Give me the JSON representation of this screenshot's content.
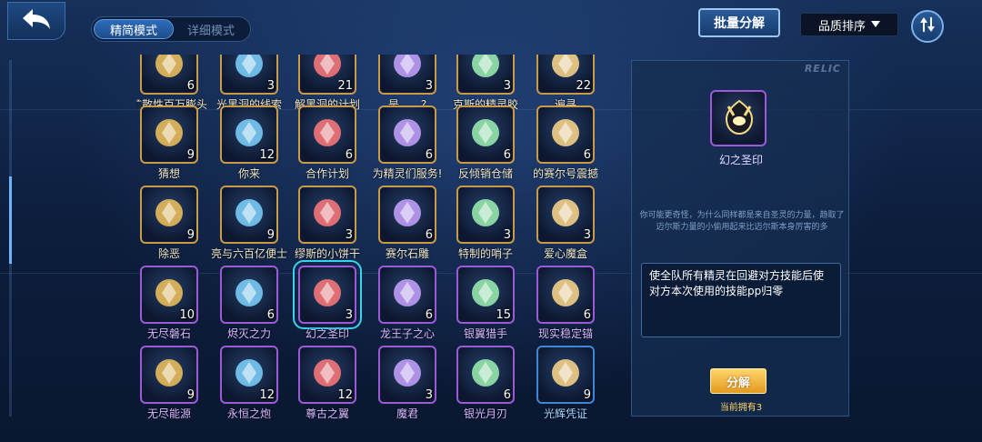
{
  "header": {
    "mode_simple": "精简模式",
    "mode_detail": "详细模式",
    "batch_decompose": "批量分解",
    "sort_label": "品质排序"
  },
  "items": [
    {
      "name": "扩散性百万膨头",
      "count": "6",
      "tier": "gold",
      "icon": "mushroom-bomb-icon"
    },
    {
      "name": "光黑洞的线索",
      "count": "3",
      "tier": "gold",
      "icon": "blackhole-clue-icon"
    },
    {
      "name": "解黑洞的计划",
      "count": "21",
      "tier": "gold",
      "icon": "blackhole-plan-icon"
    },
    {
      "name": "是……?",
      "count": "3",
      "tier": "gold",
      "icon": "robot-face-icon"
    },
    {
      "name": "克斯的精灵胶",
      "count": "3",
      "tier": "gold",
      "icon": "spirit-capsule-icon"
    },
    {
      "name": "遍寻",
      "count": "22",
      "tier": "gold",
      "icon": "search-robot-icon"
    },
    {
      "name": "猜想",
      "count": "9",
      "tier": "gold",
      "icon": "guess-robot-icon"
    },
    {
      "name": "你来",
      "count": "12",
      "tier": "gold",
      "icon": "mecha-icon"
    },
    {
      "name": "合作计划",
      "count": "6",
      "tier": "gold",
      "icon": "cooperation-plan-icon"
    },
    {
      "name": "为精灵们服务!",
      "count": "6",
      "tier": "gold",
      "icon": "service-picture-icon"
    },
    {
      "name": "反倾销仓储",
      "count": "6",
      "tier": "gold",
      "icon": "storage-box-icon"
    },
    {
      "name": "的赛尔号震撼",
      "count": "6",
      "tier": "gold",
      "icon": "seer-ship-icon"
    },
    {
      "name": "除恶",
      "count": "9",
      "tier": "gold",
      "icon": "wanted-poster-icon"
    },
    {
      "name": "亮与六百亿便士",
      "count": "9",
      "tier": "gold",
      "icon": "crystal-pile-icon"
    },
    {
      "name": "缪斯的小饼干",
      "count": "3",
      "tier": "gold",
      "icon": "cookie-icon"
    },
    {
      "name": "赛尔石雕",
      "count": "6",
      "tier": "gold",
      "icon": "stone-statue-icon"
    },
    {
      "name": "特制的哨子",
      "count": "3",
      "tier": "gold",
      "icon": "whistle-icon"
    },
    {
      "name": "爱心魔盒",
      "count": "3",
      "tier": "gold",
      "icon": "gift-box-icon"
    },
    {
      "name": "无尽磐石",
      "count": "10",
      "tier": "purple",
      "icon": "endless-rock-icon"
    },
    {
      "name": "烬灭之力",
      "count": "6",
      "tier": "purple",
      "icon": "dark-blade-icon"
    },
    {
      "name": "幻之圣印",
      "count": "3",
      "tier": "purple",
      "icon": "illusion-seal-icon",
      "selected": true
    },
    {
      "name": "龙王子之心",
      "count": "6",
      "tier": "purple",
      "icon": "dragon-heart-icon"
    },
    {
      "name": "银翼猎手",
      "count": "15",
      "tier": "purple",
      "icon": "silver-wing-icon"
    },
    {
      "name": "现实稳定锚",
      "count": "6",
      "tier": "purple",
      "icon": "stable-anchor-icon"
    },
    {
      "name": "无尽能源",
      "count": "9",
      "tier": "purple",
      "icon": "red-orb-icon"
    },
    {
      "name": "永恒之炮",
      "count": "12",
      "tier": "purple",
      "icon": "eternal-cannon-icon"
    },
    {
      "name": "尊古之翼",
      "count": "12",
      "tier": "purple",
      "icon": "ancient-wing-icon"
    },
    {
      "name": "魔君",
      "count": "3",
      "tier": "purple",
      "icon": "demon-lord-icon"
    },
    {
      "name": "银光月刃",
      "count": "6",
      "tier": "purple",
      "icon": "moon-blade-icon"
    },
    {
      "name": "光辉凭证",
      "count": "9",
      "tier": "blue",
      "icon": "radiant-sun-icon"
    }
  ],
  "detail": {
    "tag": "RELIC",
    "name": "幻之圣印",
    "lore": "你可能更奇怪，为什么同样都是来自圣灵的力量，趋取了迈尔斯力量的小偷用起来比迈尔斯本身厉害的多",
    "effect": "使全队所有精灵在回避对方技能后使对方本次使用的技能pp归零",
    "decompose_label": "分解",
    "owned_text": "当前拥有3"
  },
  "colors": {
    "gold_border": "#c89a4a",
    "purple_border": "#9c5ad8",
    "blue_border": "#3e86d6",
    "selection": "#38d4ee",
    "accent_button": "#e29a1e"
  }
}
